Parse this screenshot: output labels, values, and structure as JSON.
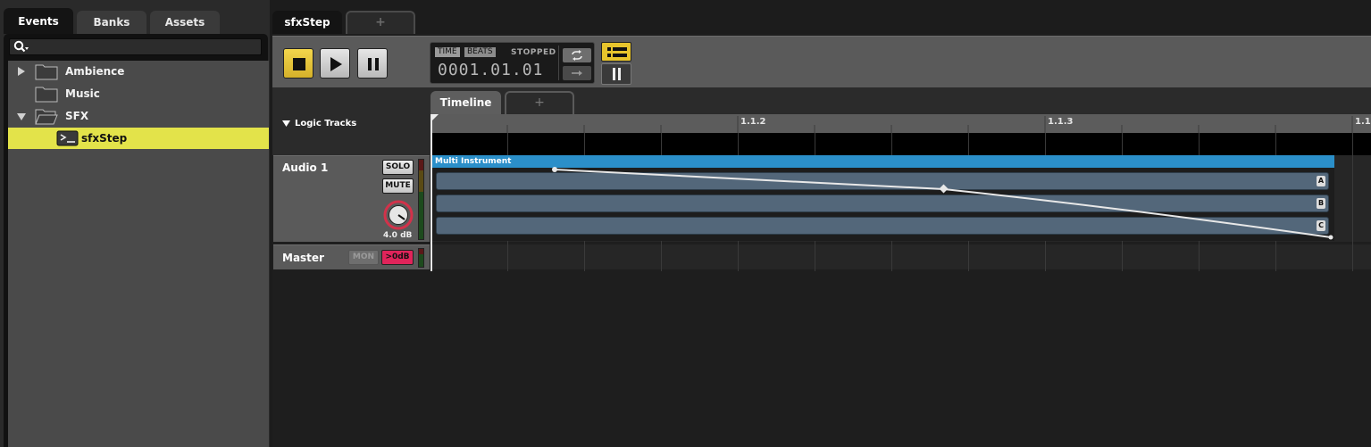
{
  "browser": {
    "tabs": [
      {
        "label": "Events",
        "active": true
      },
      {
        "label": "Banks",
        "active": false
      },
      {
        "label": "Assets",
        "active": false
      }
    ],
    "search": {
      "placeholder": ""
    },
    "tree": [
      {
        "label": "Ambience",
        "type": "folder",
        "expanded": false
      },
      {
        "label": "Music",
        "type": "folder",
        "expanded": null
      },
      {
        "label": "SFX",
        "type": "folder",
        "expanded": true
      },
      {
        "label": "sfxStep",
        "type": "event",
        "selected": true
      }
    ]
  },
  "editor": {
    "tabs": [
      {
        "label": "sfxStep",
        "active": true
      },
      {
        "label": "+",
        "active": false
      }
    ],
    "transport": {
      "time_label": "TIME",
      "beats_label": "BEATS",
      "status": "STOPPED",
      "position": "0001.01.01"
    },
    "timeline_tabs": [
      {
        "label": "Timeline",
        "active": true
      },
      {
        "label": "+",
        "active": false
      }
    ],
    "logic_tracks_label": "Logic Tracks",
    "ruler_labels": [
      "1.1.2",
      "1.1.3",
      "1.1"
    ],
    "tracks": [
      {
        "name": "Audio 1",
        "solo_label": "SOLO",
        "mute_label": "MUTE",
        "volume": "4.0 dB"
      },
      {
        "name": "Master",
        "mon_label": "MON",
        "level_label": ">0dB"
      }
    ],
    "region": {
      "title": "Multi Instrument",
      "lanes": [
        "A",
        "B",
        "C"
      ]
    }
  },
  "colors": {
    "accent_yellow": "#e3e34a",
    "region_blue": "#2b8fc9",
    "master_level_red": "#e0245a",
    "volume_ring_red": "#d2324a"
  }
}
